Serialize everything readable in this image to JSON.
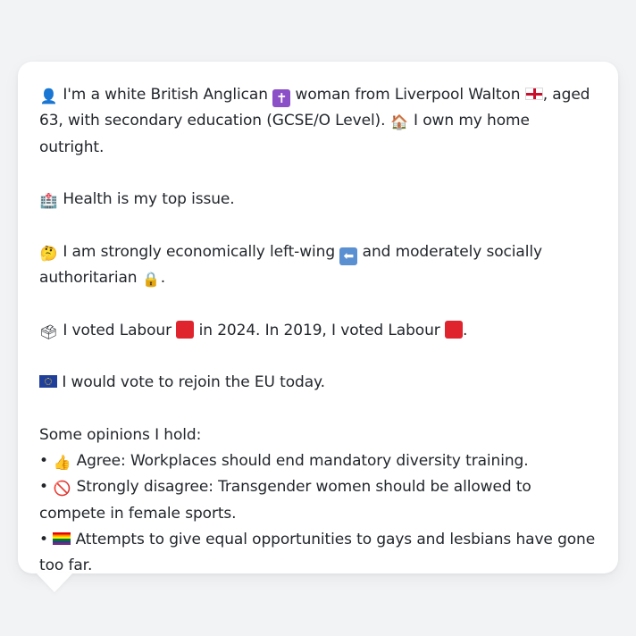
{
  "persona": {
    "line1": {
      "person_icon": "👤",
      "text_a": "I'm a white British Anglican",
      "cross_icon": "✝",
      "text_b": "woman from Liverpool Walton",
      "england_flag_icon": "england-flag",
      "text_c": ", aged 63, with secondary education (GCSE/O Level).",
      "house_icon": "🏠",
      "text_d": "I own my home outright."
    },
    "line2": {
      "hospital_icon": "🏥",
      "text": "Health is my top issue."
    },
    "line3": {
      "thinking_icon": "🤔",
      "text_a": "I am strongly economically left-wing",
      "left_arrow_icon": "⬅",
      "text_b": "and moderately socially authoritarian",
      "lock_icon": "🔒",
      "text_c": "."
    },
    "line4": {
      "ballot_icon": "🗳",
      "text_a": "I voted Labour",
      "text_b": "in 2024. In 2019, I voted Labour",
      "text_c": ".",
      "labour_color": "#e0242e"
    },
    "line5": {
      "eu_flag_icon": "eu-flag",
      "text": "I would vote to rejoin the EU today."
    },
    "opinions": {
      "heading": "Some opinions I hold:",
      "items": [
        {
          "bullet": "•",
          "icon": "👍",
          "text": "Agree: Workplaces should end mandatory diversity training."
        },
        {
          "bullet": "•",
          "icon": "🚫",
          "text": "Strongly disagree: Transgender women should be allowed to compete in female sports."
        },
        {
          "bullet": "•",
          "icon": "rainbow-flag",
          "text": "Attempts to give equal opportunities to gays and lesbians have gone too far."
        }
      ]
    }
  }
}
